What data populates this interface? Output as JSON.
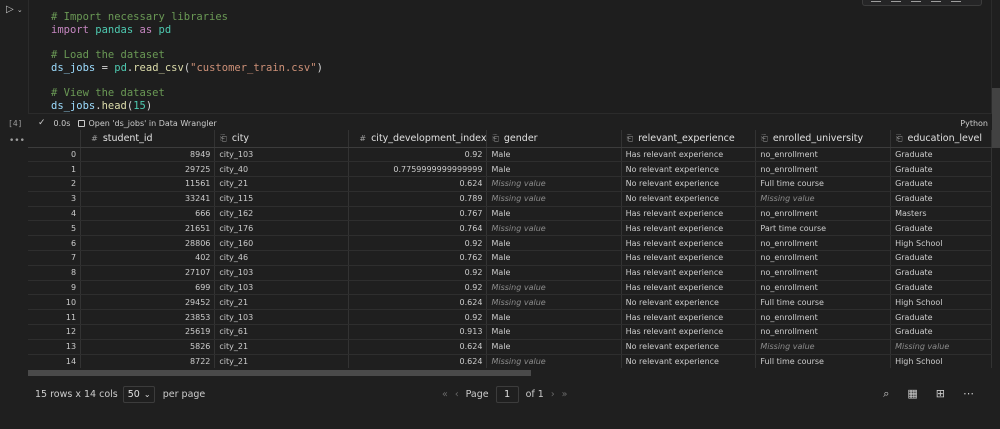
{
  "gutter": {
    "exec_count": "[4]",
    "run_glyph": "▷",
    "chevron": "⌄",
    "more_glyph": "•••"
  },
  "code": {
    "lines": [
      "# Import necessary libraries",
      "import pandas as pd",
      "",
      "# Load the dataset",
      "ds_jobs = pd.read_csv(\"customer_train.csv\")",
      "",
      "# View the dataset",
      "ds_jobs.head(15)"
    ]
  },
  "status": {
    "check": "✓",
    "time": "0.0s",
    "data_wrangler": "Open 'ds_jobs' in Data Wrangler",
    "language": "Python"
  },
  "table": {
    "columns": [
      {
        "icon": "#",
        "name": "student_id"
      },
      {
        "icon": "⎗",
        "name": "city"
      },
      {
        "icon": "#",
        "name": "city_development_index"
      },
      {
        "icon": "⎗",
        "name": "gender"
      },
      {
        "icon": "⎗",
        "name": "relevant_experience"
      },
      {
        "icon": "⎗",
        "name": "enrolled_university"
      },
      {
        "icon": "⎗",
        "name": "education_level"
      }
    ],
    "rows": [
      [
        "0",
        "8949",
        "city_103",
        "0.92",
        "Male",
        "Has relevant experience",
        "no_enrollment",
        "Graduate"
      ],
      [
        "1",
        "29725",
        "city_40",
        "0.7759999999999999",
        "Male",
        "No relevant experience",
        "no_enrollment",
        "Graduate"
      ],
      [
        "2",
        "11561",
        "city_21",
        "0.624",
        "Missing value",
        "No relevant experience",
        "Full time course",
        "Graduate"
      ],
      [
        "3",
        "33241",
        "city_115",
        "0.789",
        "Missing value",
        "No relevant experience",
        "Missing value",
        "Graduate"
      ],
      [
        "4",
        "666",
        "city_162",
        "0.767",
        "Male",
        "Has relevant experience",
        "no_enrollment",
        "Masters"
      ],
      [
        "5",
        "21651",
        "city_176",
        "0.764",
        "Missing value",
        "Has relevant experience",
        "Part time course",
        "Graduate"
      ],
      [
        "6",
        "28806",
        "city_160",
        "0.92",
        "Male",
        "Has relevant experience",
        "no_enrollment",
        "High School"
      ],
      [
        "7",
        "402",
        "city_46",
        "0.762",
        "Male",
        "Has relevant experience",
        "no_enrollment",
        "Graduate"
      ],
      [
        "8",
        "27107",
        "city_103",
        "0.92",
        "Male",
        "Has relevant experience",
        "no_enrollment",
        "Graduate"
      ],
      [
        "9",
        "699",
        "city_103",
        "0.92",
        "Missing value",
        "Has relevant experience",
        "no_enrollment",
        "Graduate"
      ],
      [
        "10",
        "29452",
        "city_21",
        "0.624",
        "Missing value",
        "No relevant experience",
        "Full time course",
        "High School"
      ],
      [
        "11",
        "23853",
        "city_103",
        "0.92",
        "Male",
        "Has relevant experience",
        "no_enrollment",
        "Graduate"
      ],
      [
        "12",
        "25619",
        "city_61",
        "0.913",
        "Male",
        "Has relevant experience",
        "no_enrollment",
        "Graduate"
      ],
      [
        "13",
        "5826",
        "city_21",
        "0.624",
        "Male",
        "No relevant experience",
        "Missing value",
        "Missing value"
      ],
      [
        "14",
        "8722",
        "city_21",
        "0.624",
        "Missing value",
        "No relevant experience",
        "Full time course",
        "High School"
      ]
    ],
    "missing_label": "Missing value"
  },
  "footer": {
    "rows_cols": "15 rows x 14 cols",
    "page_size": "50",
    "per_page": "per page",
    "page_label": "Page",
    "page_value": "1",
    "of_label": "of 1",
    "icons": [
      "search-icon",
      "columns-icon",
      "grid-icon",
      "more-icon"
    ]
  },
  "colors": {
    "background": "#1f1f1f",
    "comment": "#6a9955",
    "keyword": "#c586c0",
    "string": "#ce9178",
    "missing": "#8c8c8c"
  }
}
